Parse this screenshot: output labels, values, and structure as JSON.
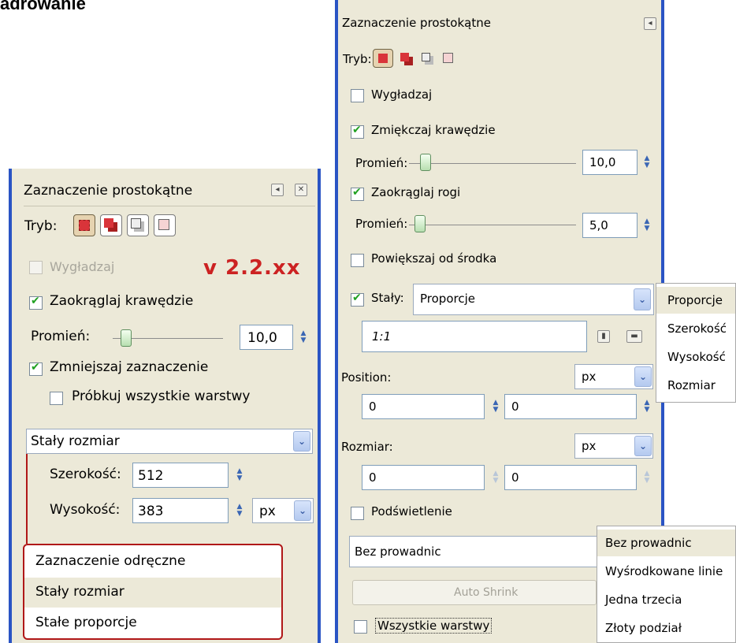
{
  "heading": "adrowanie",
  "left_panel": {
    "title": "Zaznaczenie prostokątne",
    "mode_label": "Tryb:",
    "antialias_label": "Wygładzaj",
    "version_label": "v 2.2.xx",
    "rounded_label": "Zaokrąglaj krawędzie",
    "radius_label": "Promień:",
    "radius_value": "10,0",
    "shrink_label": "Zmniejszaj zaznaczenie",
    "sample_label": "Próbkuj wszystkie warstwy",
    "fixed_value": "Stały rozmiar",
    "width_label": "Szerokość:",
    "width_value": "512",
    "height_label": "Wysokość:",
    "height_value": "383",
    "unit_value": "px",
    "dropdown_options": [
      "Zaznaczenie odręczne",
      "Stały rozmiar",
      "Stałe proporcje"
    ]
  },
  "right_panel": {
    "title": "Zaznaczenie prostokątne",
    "mode_label": "Tryb:",
    "antialias_label": "Wygładzaj",
    "feather_label": "Zmiękczaj krawędzie",
    "feather_radius_label": "Promień:",
    "feather_radius_value": "10,0",
    "rounded_label": "Zaokrąglaj rogi",
    "rounded_radius_label": "Promień:",
    "rounded_radius_value": "5,0",
    "expand_label": "Powiększaj od środka",
    "fixed_label": "Stały:",
    "fixed_value": "Proporcje",
    "ratio_value": "1:1",
    "position_label": "Position:",
    "position_unit": "px",
    "position_x": "0",
    "position_y": "0",
    "size_label": "Rozmiar:",
    "size_unit": "px",
    "size_w": "0",
    "size_h": "0",
    "highlight_label": "Podświetlenie",
    "guides_value": "Bez prowadnic",
    "auto_shrink_label": "Auto Shrink",
    "all_layers_label": "Wszystkie warstwy"
  },
  "fixed_menu": {
    "items": [
      "Proporcje",
      "Szerokość",
      "Wysokość",
      "Rozmiar"
    ]
  },
  "guides_menu": {
    "items": [
      "Bez prowadnic",
      "Wyśrodkowane linie",
      "Jedna trzecia",
      "Złoty podział"
    ]
  },
  "colors": {
    "accent_blue": "#2a54c4",
    "version_red": "#cc2222",
    "callout_red": "#b01818",
    "panel_bg": "#ece9d8"
  }
}
